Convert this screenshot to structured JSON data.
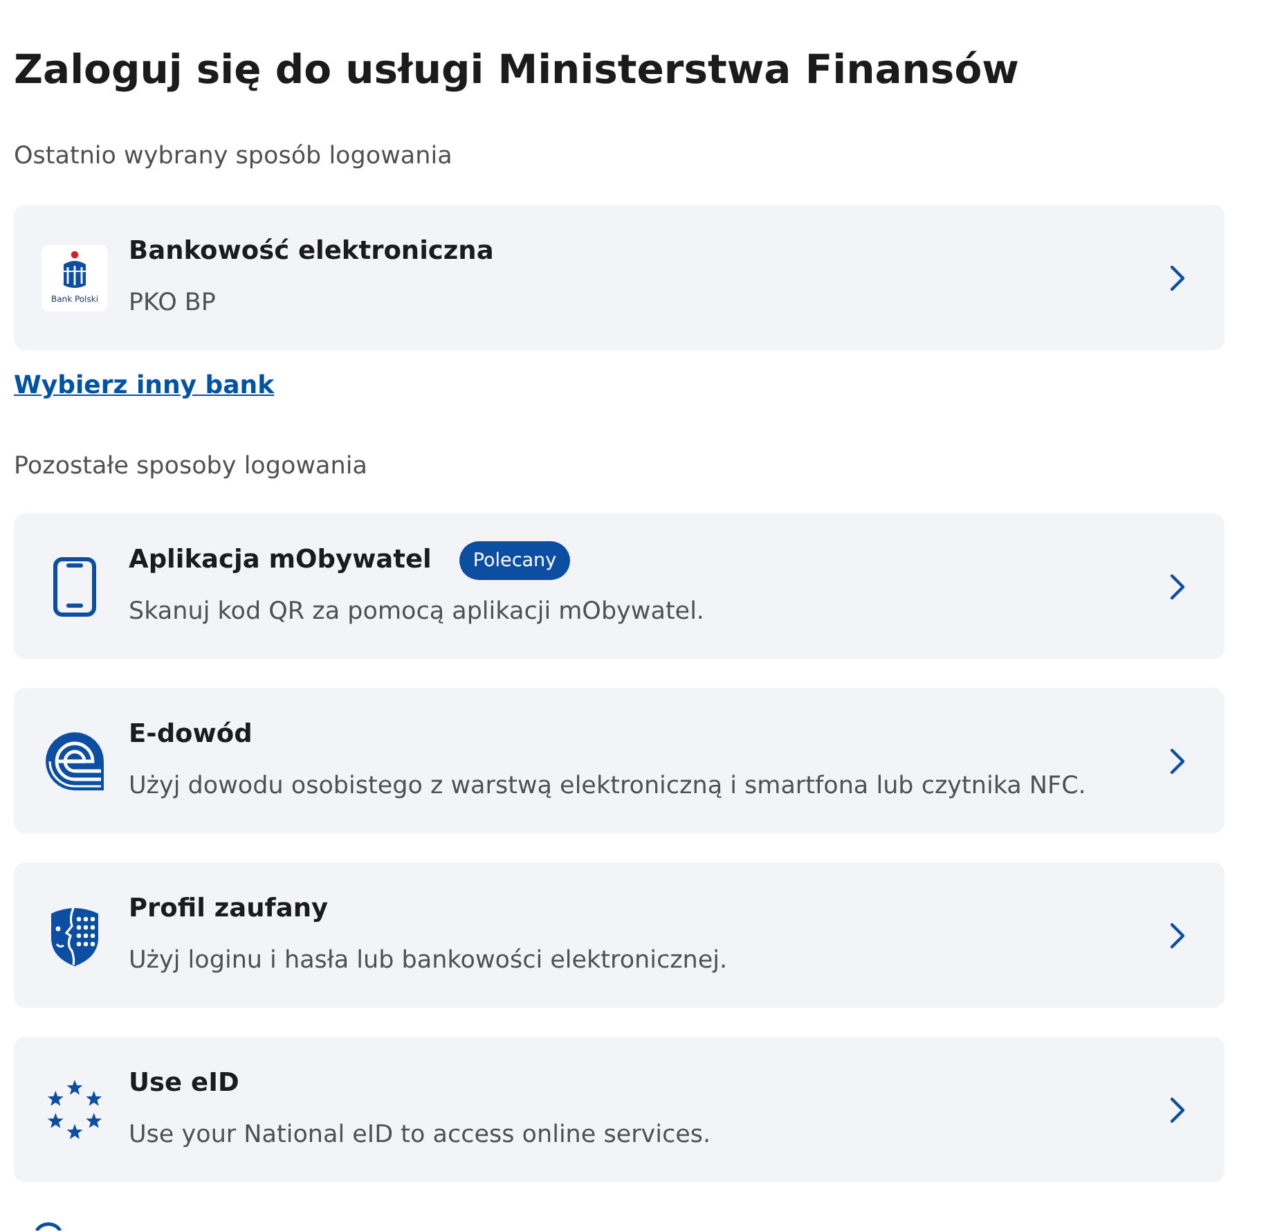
{
  "title": "Zaloguj się do usługi Ministerstwa Finansów",
  "recent_section": {
    "label": "Ostatnio wybrany sposób logowania",
    "options": [
      {
        "kind": "bank",
        "logo_text": "Bank Polski",
        "title": "Bankowość elektroniczna",
        "subtitle": "PKO BP"
      }
    ]
  },
  "change_bank_link": "Wybierz inny bank",
  "other_section": {
    "label": "Pozostałe sposoby logowania",
    "options": [
      {
        "kind": "phone",
        "title": "Aplikacja mObywatel",
        "badge": "Polecany",
        "subtitle": "Skanuj kod QR za pomocą aplikacji mObywatel."
      },
      {
        "kind": "edowod",
        "title": "E-dowód",
        "subtitle": "Użyj dowodu osobistego z warstwą elektroniczną i smartfona lub czytnika NFC."
      },
      {
        "kind": "shield",
        "title": "Profil zaufany",
        "subtitle": "Użyj loginu i hasła lub bankowości elektronicznej."
      },
      {
        "kind": "stars",
        "title": "Use eID",
        "subtitle": "Use your National eID to access online services."
      }
    ]
  }
}
